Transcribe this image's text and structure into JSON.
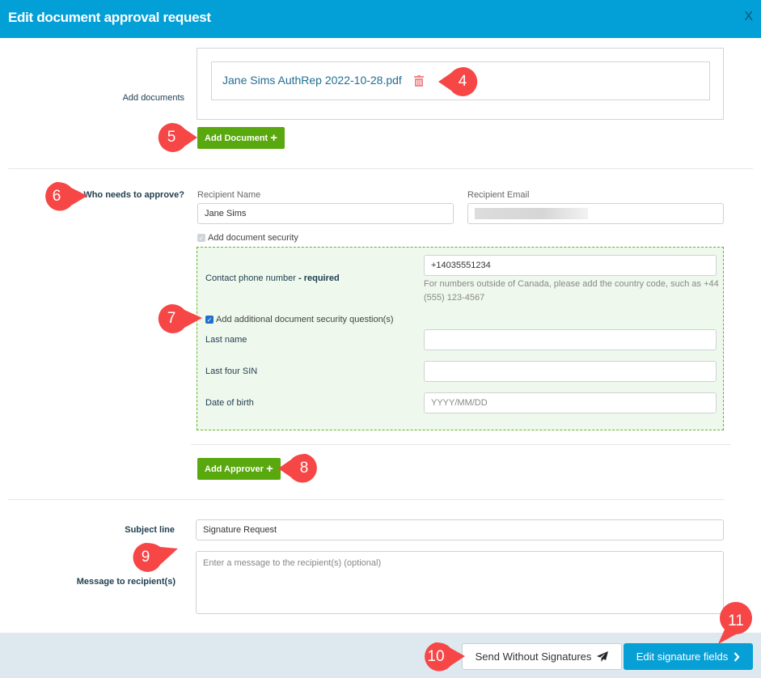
{
  "dialog": {
    "title": "Edit document approval request",
    "close_label": "X"
  },
  "documents": {
    "label": "Add documents",
    "files": [
      {
        "name": "Jane Sims AuthRep 2022-10-28.pdf"
      }
    ],
    "add_button": "Add Document",
    "delete_icon": "trash-icon"
  },
  "approvers": {
    "label": "Who needs to approve?",
    "recipient_name_label": "Recipient Name",
    "recipient_name_value": "Jane Sims",
    "recipient_email_label": "Recipient Email",
    "recipient_email_value": "",
    "document_security": {
      "label": "Add document security",
      "checked": true,
      "disabled": true
    },
    "security": {
      "phone_label": "Contact phone number",
      "phone_required": "- required",
      "phone_value": "+14035551234",
      "phone_hint": "For numbers outside of Canada, please add the country code, such as +44 (555) 123-4567",
      "additional_questions": {
        "label": "Add additional document security question(s)",
        "checked": true
      },
      "last_name_label": "Last name",
      "last_name_value": "",
      "last_four_sin_label": "Last four SIN",
      "last_four_sin_value": "",
      "dob_label": "Date of birth",
      "dob_placeholder": "YYYY/MM/DD"
    },
    "add_button": "Add Approver"
  },
  "message": {
    "subject_label": "Subject line",
    "subject_value": "Signature Request",
    "message_label": "Message to recipient(s)",
    "message_placeholder": "Enter a message to the recipient(s) (optional)"
  },
  "footer": {
    "send_button": "Send Without Signatures",
    "send_icon": "paper-plane-icon",
    "edit_button": "Edit signature fields",
    "edit_icon": "chevron-right-icon"
  },
  "callouts": [
    "4",
    "5",
    "6",
    "7",
    "8",
    "9",
    "10",
    "11"
  ],
  "colors": {
    "header": "#03a0d7",
    "green_button": "#58a80e",
    "blue_button": "#069fd6",
    "callout": "#f64646",
    "security_box_bg": "#eff8ed"
  }
}
